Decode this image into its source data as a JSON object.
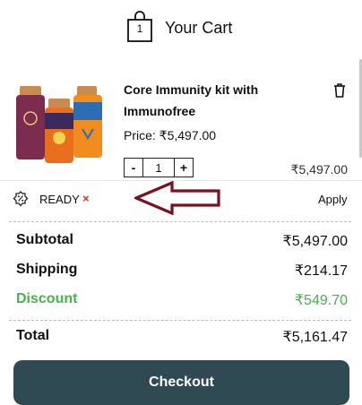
{
  "header": {
    "title": "Your Cart",
    "bag_count": "1"
  },
  "cart_item": {
    "name": "Core Immunity kit with Immunofree",
    "price": "Price: ₹5,497.00",
    "quantity": "1",
    "minus": "-",
    "plus": "+",
    "line_total": "₹5,497.00"
  },
  "coupon": {
    "code": "READY",
    "remove": "×",
    "apply": "Apply"
  },
  "summary": {
    "subtotal_label": "Subtotal",
    "subtotal_value": "₹5,497.00",
    "shipping_label": "Shipping",
    "shipping_value": "₹214.17",
    "discount_label": "Discount",
    "discount_value": "₹549.70",
    "total_label": "Total",
    "total_value": "₹5,161.47"
  },
  "checkout_label": "Checkout",
  "colors": {
    "checkout_bg": "#2f4a52",
    "discount": "#4caf50",
    "remove": "#dd3322",
    "arrow": "#7a1020"
  }
}
